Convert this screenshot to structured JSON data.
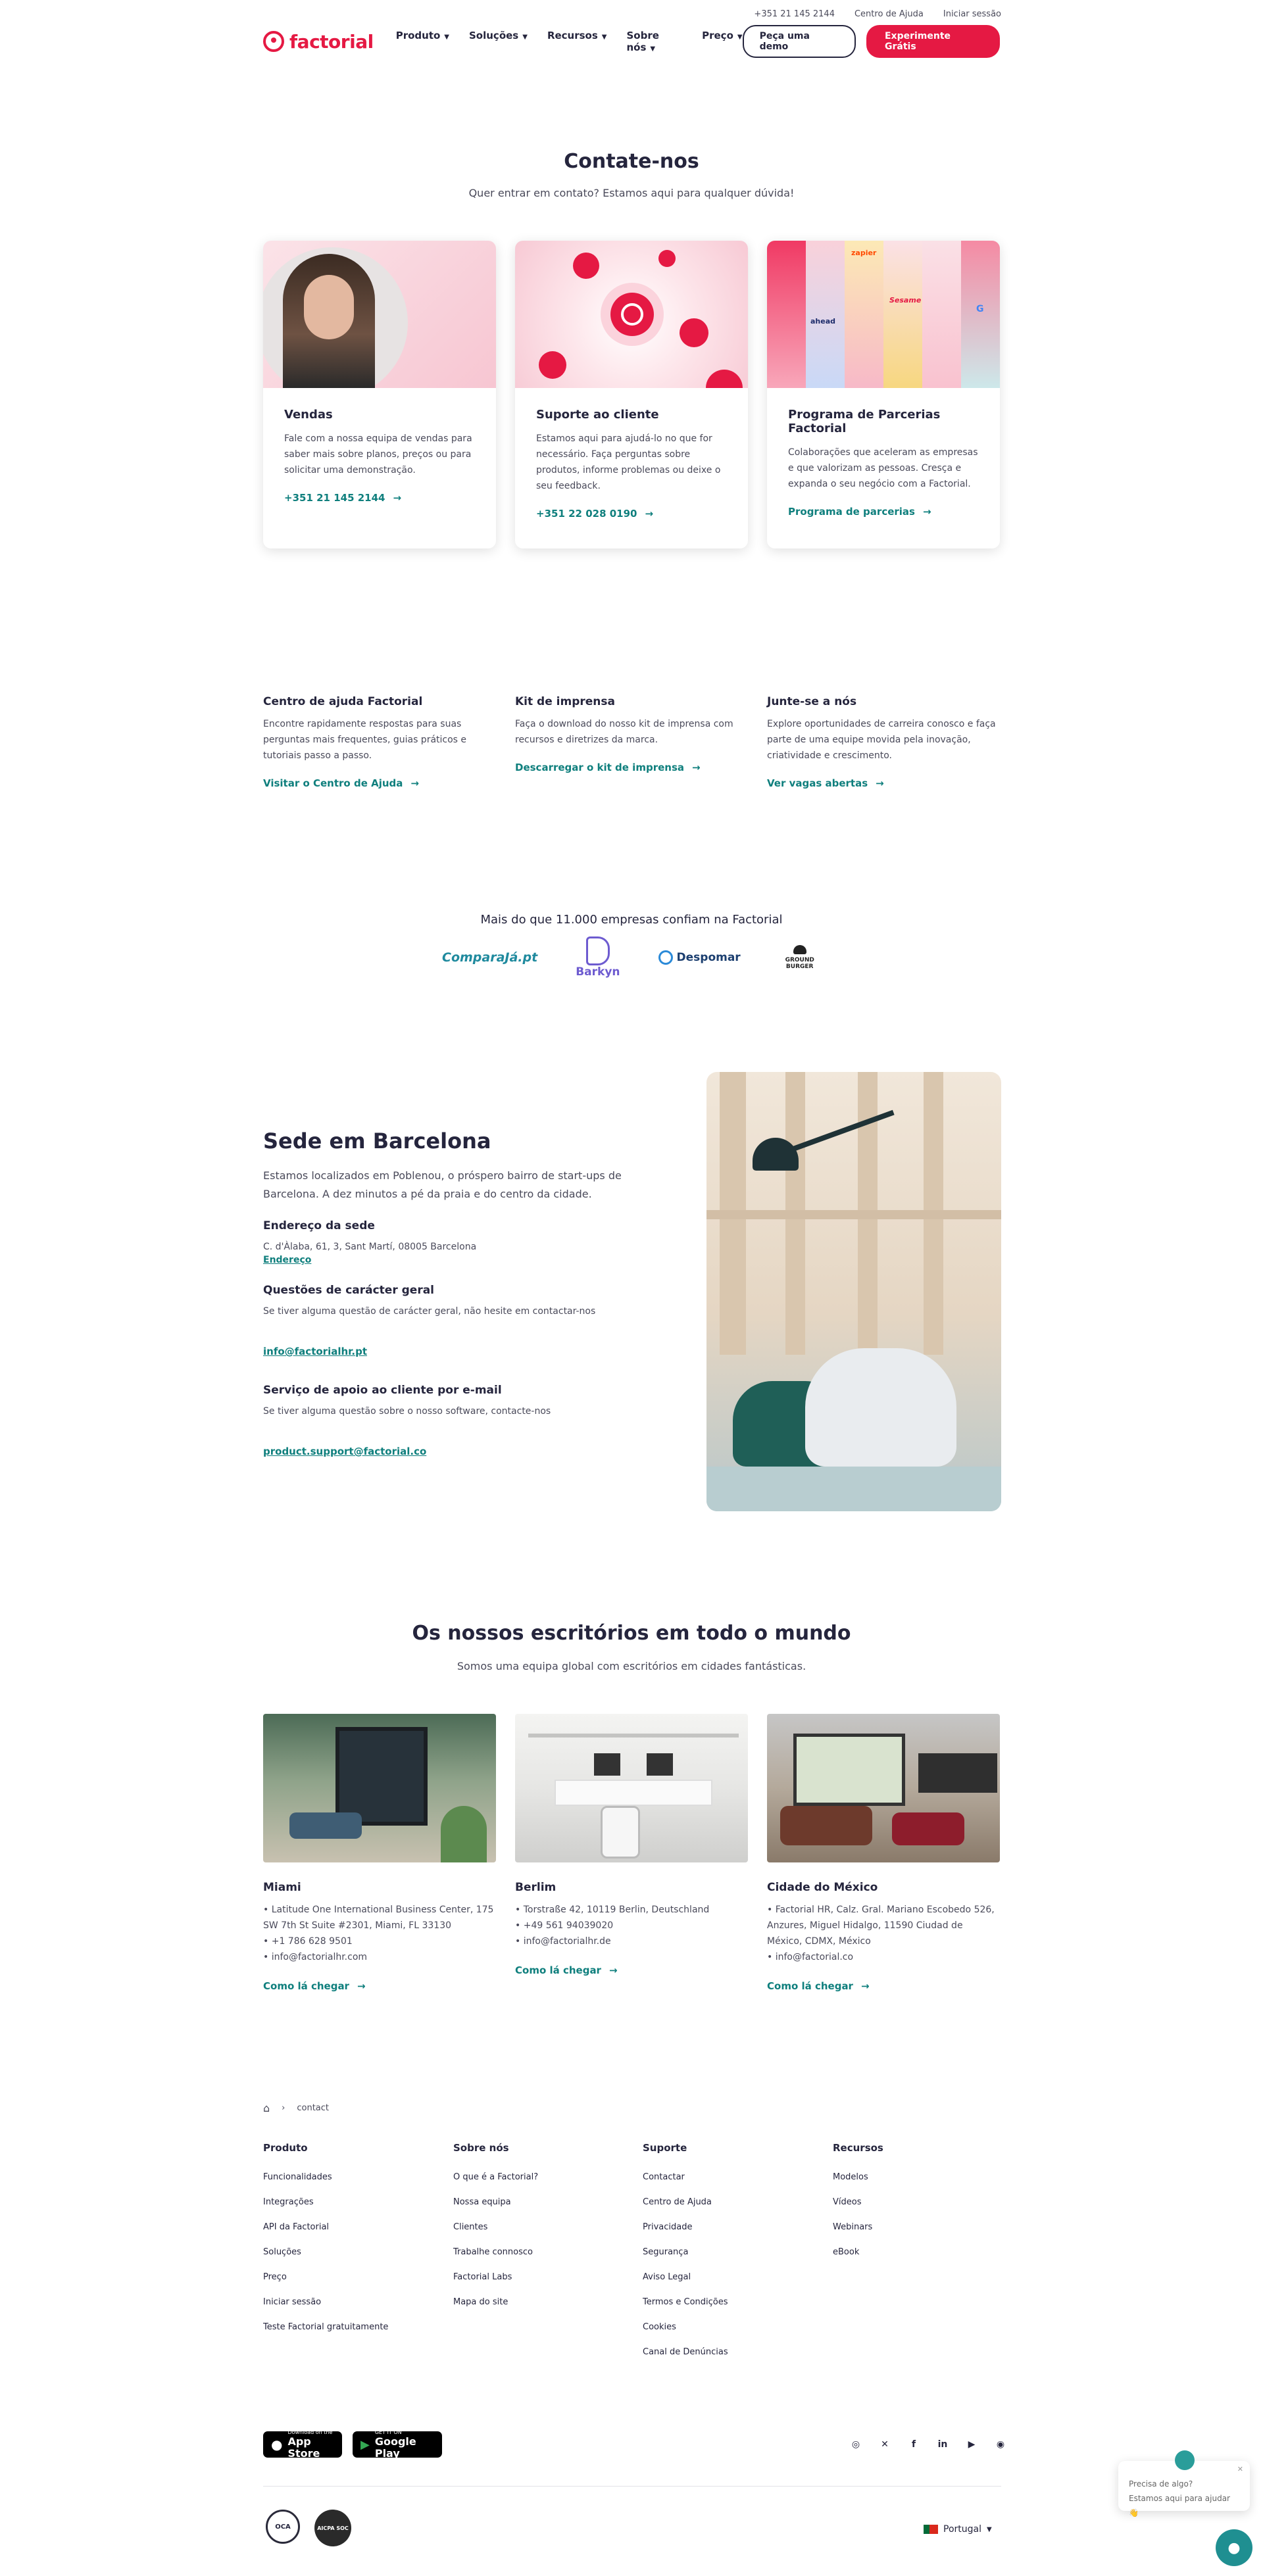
{
  "topbar": {
    "phone": "+351 21 145 2144",
    "help": "Centro de Ajuda",
    "login": "Iniciar sessão"
  },
  "nav": {
    "logo": "factorial",
    "items": [
      {
        "label": "Produto"
      },
      {
        "label": "Soluções"
      },
      {
        "label": "Recursos"
      },
      {
        "label": "Sobre nós"
      },
      {
        "label": "Preço"
      }
    ],
    "demo": "Peça uma demo",
    "trial": "Experimente Grátis"
  },
  "hero": {
    "title": "Contate-nos",
    "subtitle": "Quer entrar em contato? Estamos aqui para qualquer dúvida!"
  },
  "cards": [
    {
      "title": "Vendas",
      "text": "Fale com a nossa equipa de vendas para saber mais sobre planos, preços ou para solicitar uma demonstração.",
      "link": "+351 21 145 2144"
    },
    {
      "title": "Suporte ao cliente",
      "text": "Estamos aqui para ajudá-lo no que for necessário. Faça perguntas sobre produtos, informe problemas ou deixe o seu feedback.",
      "link": "+351 22 028 0190"
    },
    {
      "title": "Programa de Parcerias Factorial",
      "text": "Colaborações que aceleram as empresas e que valorizam as pessoas. Cresça e expanda o seu negócio com a Factorial.",
      "link": "Programa de parcerias"
    }
  ],
  "partner_logos": [
    "zapier",
    "Sesame",
    "ahead",
    "G"
  ],
  "resources": [
    {
      "title": "Centro de ajuda Factorial",
      "text": "Encontre rapidamente respostas para suas perguntas mais frequentes, guias práticos e tutoriais passo a passo.",
      "link": "Visitar o Centro de Ajuda"
    },
    {
      "title": "Kit de imprensa",
      "text": "Faça o download do nosso kit de imprensa com recursos e diretrizes da marca.",
      "link": "Descarregar o kit de imprensa"
    },
    {
      "title": "Junte-se a nós",
      "text": "Explore oportunidades de carreira conosco e faça parte de uma equipe movida pela inovação, criatividade e crescimento.",
      "link": "Ver vagas abertas"
    }
  ],
  "trust": {
    "title": "Mais do que 11.000 empresas confiam na Factorial",
    "logos": [
      "ComparaJá.pt",
      "Barkyn",
      "Despomar",
      "GROUND BURGER"
    ]
  },
  "hq": {
    "title": "Sede em Barcelona",
    "text": "Estamos localizados em Poblenou, o próspero bairro de start-ups de Barcelona. A dez minutos a pé da praia e do centro da cidade.",
    "address_title": "Endereço da sede",
    "address": "C. d'Àlaba, 61, 3, Sant Martí, 08005 Barcelona",
    "address_link": "Endereço",
    "general_title": "Questões de carácter geral",
    "general_text": "Se tiver alguma questão de carácter geral, não hesite em contactar-nos",
    "general_email": "info@factorialhr.pt",
    "support_title": "Serviço de apoio ao cliente por e-mail",
    "support_text": "Se tiver alguma questão sobre o nosso software, contacte-nos",
    "support_email": "product.support@factorial.co"
  },
  "offices": {
    "title": "Os nossos escritórios em todo o mundo",
    "subtitle": "Somos uma equipa global com escritórios em cidades fantásticas.",
    "items": [
      {
        "city": "Miami",
        "lines": [
          "• Latitude One International Business Center, 175 SW 7th St Suite #2301, Miami, FL 33130",
          "• +1 786 628 9501",
          "• info@factorialhr.com"
        ],
        "link": "Como lá chegar"
      },
      {
        "city": "Berlim",
        "lines": [
          "• Torstraße 42, 10119 Berlin, Deutschland",
          "• +49 561 94039020",
          "• info@factorialhr.de"
        ],
        "link": "Como lá chegar"
      },
      {
        "city": "Cidade do México",
        "lines": [
          "• Factorial HR, Calz. Gral. Mariano Escobedo 526, Anzures, Miguel Hidalgo, 11590 Ciudad de México, CDMX, México",
          "• info@factorial.co"
        ],
        "link": "Como lá chegar"
      }
    ]
  },
  "breadcrumb": {
    "current": "contact"
  },
  "footer": {
    "columns": [
      {
        "title": "Produto",
        "items": [
          "Funcionalidades",
          "Integrações",
          "API da Factorial",
          "Soluções",
          "Preço",
          "Iniciar sessão",
          "Teste Factorial gratuitamente"
        ]
      },
      {
        "title": "Sobre nós",
        "items": [
          "O que é a Factorial?",
          "Nossa equipa",
          "Clientes",
          "Trabalhe connosco",
          "Factorial Labs",
          "Mapa do site"
        ]
      },
      {
        "title": "Suporte",
        "items": [
          "Contactar",
          "Centro de Ajuda",
          "Privacidade",
          "Segurança",
          "Aviso Legal",
          "Termos e Condições",
          "Cookies",
          "Canal de Denúncias"
        ]
      },
      {
        "title": "Recursos",
        "items": [
          "Modelos",
          "Vídeos",
          "Webinars",
          "eBook"
        ]
      }
    ],
    "appstore_small": "Download on the",
    "appstore_big": "App Store",
    "gplay_small": "GET IT ON",
    "gplay_big": "Google Play",
    "language": "Portugal",
    "badges": [
      "OCA",
      "AICPA SOC"
    ]
  },
  "chat": {
    "line1": "Precisa de algo?",
    "line2": "Estamos aqui para ajudar👋"
  },
  "colors": {
    "brand": "#e51943",
    "link": "#0f7f7d",
    "text": "#25253d"
  }
}
